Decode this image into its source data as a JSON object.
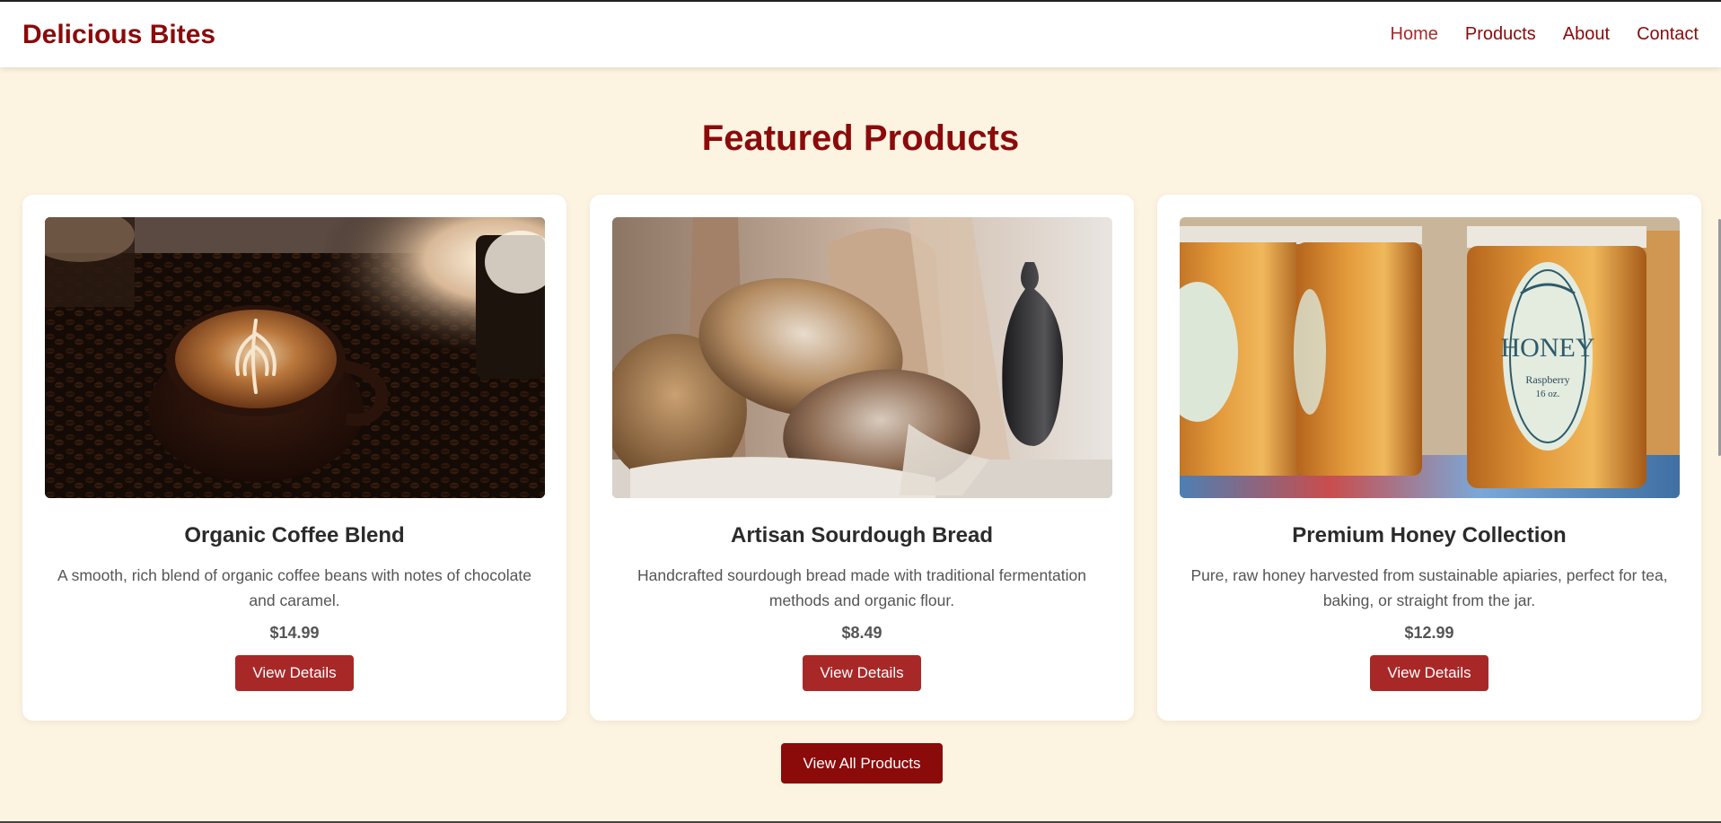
{
  "header": {
    "brand": "Delicious Bites",
    "nav": [
      {
        "label": "Home",
        "active": true
      },
      {
        "label": "Products",
        "active": false
      },
      {
        "label": "About",
        "active": false
      },
      {
        "label": "Contact",
        "active": false
      }
    ]
  },
  "main": {
    "section_title": "Featured Products",
    "products": [
      {
        "title": "Organic Coffee Blend",
        "description": "A smooth, rich blend of organic coffee beans with notes of chocolate and caramel.",
        "price": "$14.99",
        "button": "View Details",
        "image": "coffee-latte-photo"
      },
      {
        "title": "Artisan Sourdough Bread",
        "description": "Handcrafted sourdough bread made with traditional fermentation methods and organic flour.",
        "price": "$8.49",
        "button": "View Details",
        "image": "sourdough-bread-photo"
      },
      {
        "title": "Premium Honey Collection",
        "description": "Pure, raw honey harvested from sustainable apiaries, perfect for tea, baking, or straight from the jar.",
        "price": "$12.99",
        "button": "View Details",
        "image": "honey-jars-photo",
        "label_text": [
          "HONEY",
          "Raspberry",
          "16 oz."
        ]
      }
    ],
    "view_all_label": "View All Products"
  },
  "colors": {
    "brand": "#8b0a0a",
    "button": "#a82828",
    "background": "#fdf3e1",
    "card": "#ffffff"
  }
}
